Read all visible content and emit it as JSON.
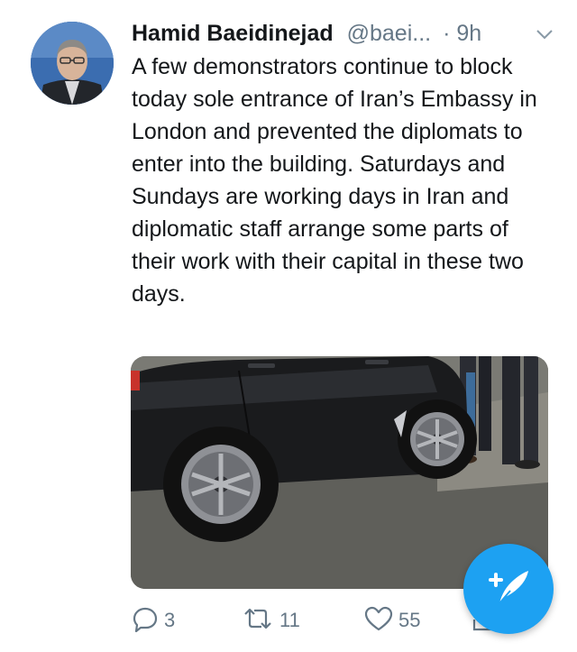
{
  "tweet": {
    "author_name": "Hamid Baeidinejad",
    "handle": "@baei...",
    "time": "· 9h",
    "text": "A few demonstrators continue to block today sole entrance of Iran’s Embassy in London and prevented the diplomats to enter into the building. Saturdays and Sundays are working days in Iran and diplomatic staff arrange some parts of their work with their capital in these two days."
  },
  "actions": {
    "reply_count": "3",
    "retweet_count": "11",
    "like_count": "55"
  },
  "icons": {
    "reply": "reply-icon",
    "retweet": "retweet-icon",
    "like": "heart-icon",
    "share": "share-icon",
    "compose": "compose-tweet-icon",
    "caret": "chevron-down-icon"
  },
  "colors": {
    "accent": "#1da1f2",
    "secondary_text": "#657786",
    "primary_text": "#14171a"
  }
}
